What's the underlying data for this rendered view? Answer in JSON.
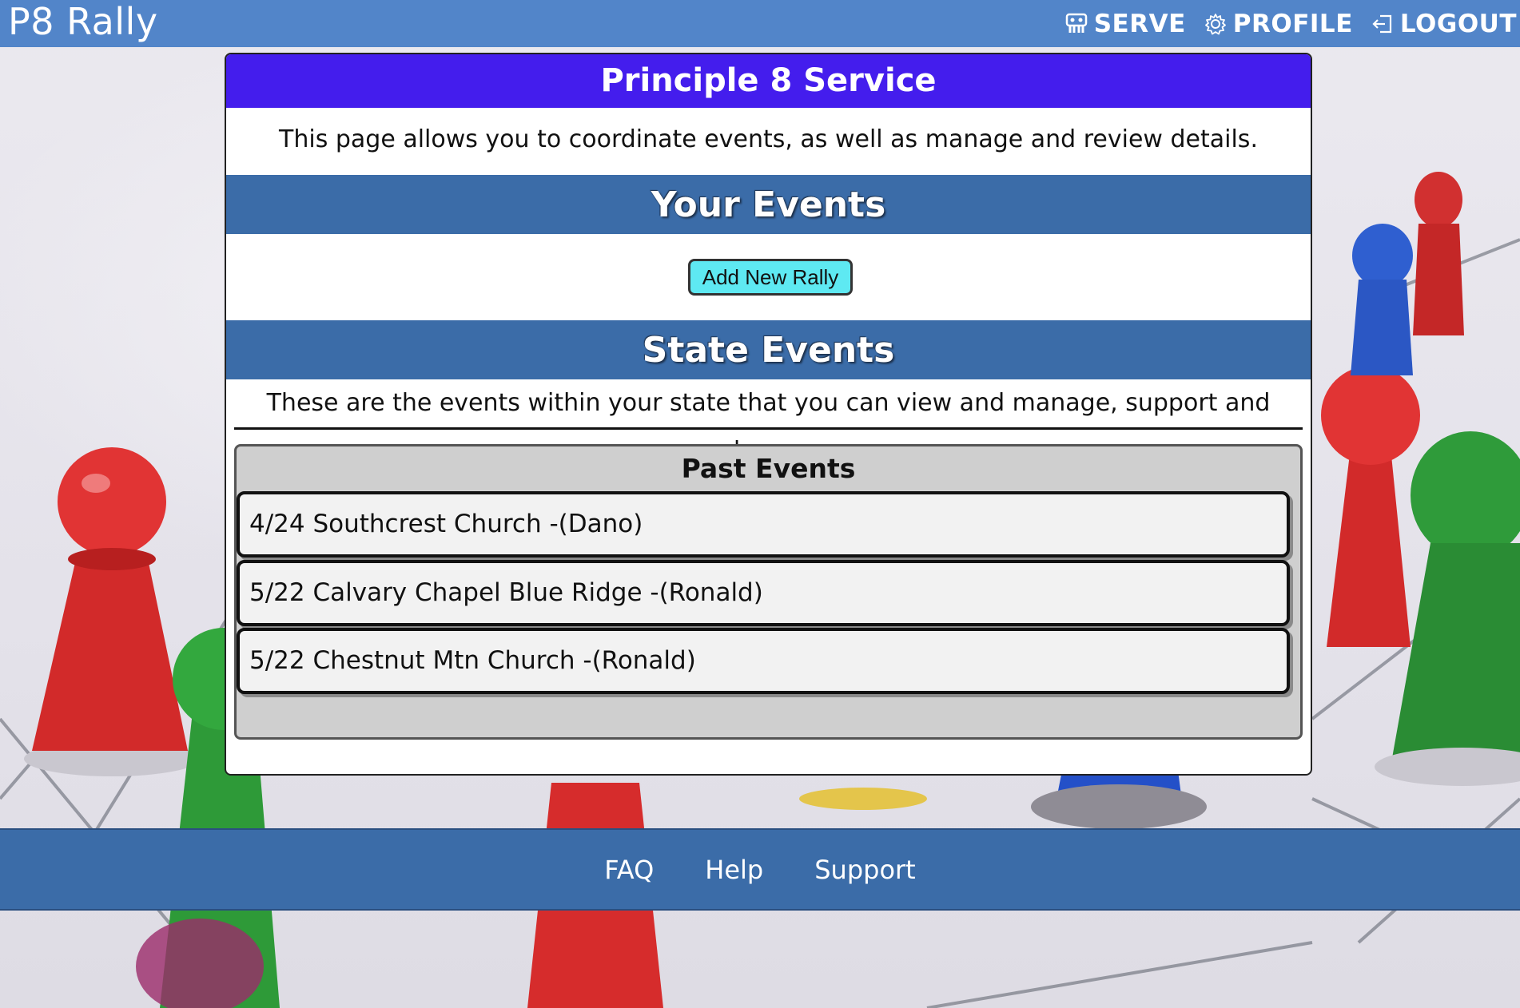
{
  "brand": "P8 Rally",
  "nav": {
    "serve": "SERVE",
    "profile": "PROFILE",
    "logout": "LOGOUT"
  },
  "card": {
    "title": "Principle 8 Service",
    "intro": "This page allows you to coordinate events, as well as manage and review details.",
    "your_events_heading": "Your Events",
    "add_rally_label": "Add New Rally",
    "state_events_heading": "State Events",
    "state_events_desc": "These are the events within your state that you can view and manage, support and change.",
    "past_events_title": "Past Events",
    "past_events": [
      {
        "label": "4/24  Southcrest Church -(Dano)"
      },
      {
        "label": "5/22  Calvary Chapel Blue Ridge -(Ronald)"
      },
      {
        "label": "5/22  Chestnut Mtn Church -(Ronald)"
      }
    ]
  },
  "footer": {
    "faq": "FAQ",
    "help": "Help",
    "support": "Support"
  },
  "colors": {
    "topbar": "#5285c9",
    "card_header": "#441ded",
    "section_band": "#3b6ca8",
    "add_button": "#5ee9f2",
    "footer": "#3b6ca8"
  },
  "icons": {
    "serve": "serve-hands-icon",
    "profile": "gear-icon",
    "logout": "logout-arrow-icon"
  }
}
